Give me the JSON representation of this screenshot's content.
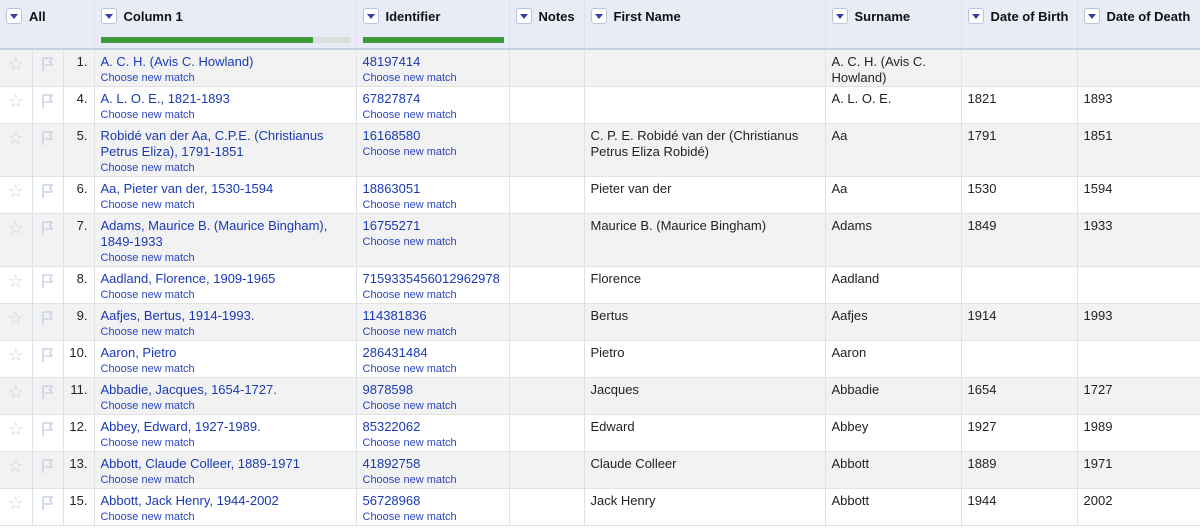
{
  "header": {
    "all_label": "All",
    "columns": [
      "Column 1",
      "Identifier",
      "Notes",
      "First Name",
      "Surname",
      "Date of Birth",
      "Date of Death"
    ]
  },
  "progress": {
    "column1": 0.85,
    "identifier": 1.0
  },
  "choose_label": "Choose new match",
  "rows": [
    {
      "index": "1.",
      "col1": "A. C. H. (Avis C. Howland)",
      "id": "48197414",
      "notes": "",
      "first": "",
      "surname": "A. C. H. (Avis C. Howland)",
      "birth": "",
      "death": ""
    },
    {
      "index": "4.",
      "col1": "A. L. O. E., 1821-1893",
      "id": "67827874",
      "notes": "",
      "first": "",
      "surname": "A. L. O. E.",
      "birth": "1821",
      "death": "1893"
    },
    {
      "index": "5.",
      "col1": "Robidé van der Aa, C.P.E. (Christianus Petrus Eliza), 1791-1851",
      "id": "16168580",
      "notes": "",
      "first": "C. P. E. Robidé van der (Christianus Petrus Eliza Robidé)",
      "surname": "Aa",
      "birth": "1791",
      "death": "1851"
    },
    {
      "index": "6.",
      "col1": "Aa, Pieter van der, 1530-1594",
      "id": "18863051",
      "notes": "",
      "first": "Pieter van der",
      "surname": "Aa",
      "birth": "1530",
      "death": "1594"
    },
    {
      "index": "7.",
      "col1": "Adams, Maurice B. (Maurice Bingham), 1849-1933",
      "id": "16755271",
      "notes": "",
      "first": "Maurice B. (Maurice Bingham)",
      "surname": "Adams",
      "birth": "1849",
      "death": "1933"
    },
    {
      "index": "8.",
      "col1": "Aadland, Florence, 1909-1965",
      "id": "715933545601296​2978",
      "notes": "",
      "first": "Florence",
      "surname": "Aadland",
      "birth": "",
      "death": ""
    },
    {
      "index": "9.",
      "col1": "Aafjes, Bertus, 1914-1993.",
      "id": "114381836",
      "notes": "",
      "first": "Bertus",
      "surname": "Aafjes",
      "birth": "1914",
      "death": "1993"
    },
    {
      "index": "10.",
      "col1": "Aaron, Pietro",
      "id": "286431484",
      "notes": "",
      "first": "Pietro",
      "surname": "Aaron",
      "birth": "",
      "death": ""
    },
    {
      "index": "11.",
      "col1": "Abbadie, Jacques, 1654-1727.",
      "id": "9878598",
      "notes": "",
      "first": "Jacques",
      "surname": "Abbadie",
      "birth": "1654",
      "death": "1727"
    },
    {
      "index": "12.",
      "col1": "Abbey, Edward, 1927-1989.",
      "id": "85322062",
      "notes": "",
      "first": "Edward",
      "surname": "Abbey",
      "birth": "1927",
      "death": "1989"
    },
    {
      "index": "13.",
      "col1": "Abbott, Claude Colleer, 1889-1971",
      "id": "41892758",
      "notes": "",
      "first": "Claude Colleer",
      "surname": "Abbott",
      "birth": "1889",
      "death": "1971"
    },
    {
      "index": "15.",
      "col1": "Abbott, Jack Henry, 1944-2002",
      "id": "56728968",
      "notes": "",
      "first": "Jack Henry",
      "surname": "Abbott",
      "birth": "1944",
      "death": "2002"
    }
  ],
  "icons": {
    "star": "star-icon",
    "flag": "flag-icon",
    "dropdown": "dropdown-arrow-icon"
  }
}
